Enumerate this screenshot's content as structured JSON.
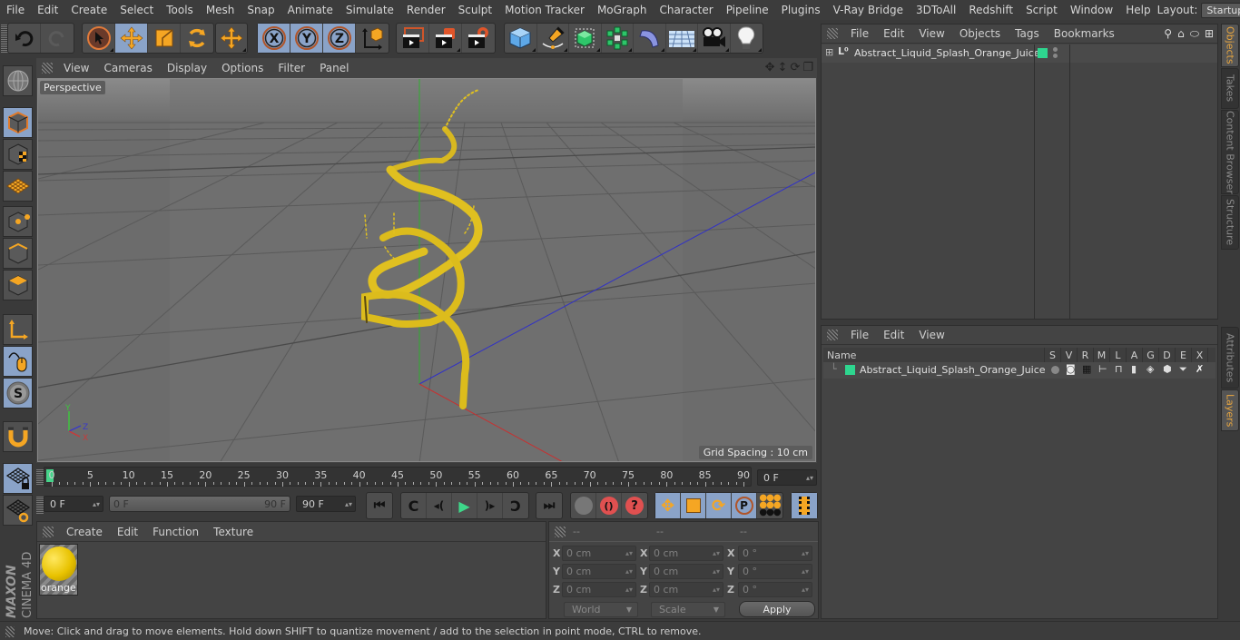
{
  "menubar": {
    "items": [
      "File",
      "Edit",
      "Create",
      "Select",
      "Tools",
      "Mesh",
      "Snap",
      "Animate",
      "Simulate",
      "Render",
      "Sculpt",
      "Motion Tracker",
      "MoGraph",
      "Character",
      "Pipeline",
      "Plugins",
      "V-Ray Bridge",
      "3DToAll",
      "Redshift",
      "Script",
      "Window",
      "Help"
    ],
    "layout_label": "Layout:",
    "layout_value": "Startup"
  },
  "toolbar": {
    "undo": "undo-icon",
    "redo": "redo-icon",
    "tools": [
      "live-selection",
      "move",
      "scale",
      "rotate",
      "recent-tool"
    ],
    "axis": [
      "X",
      "Y",
      "Z"
    ],
    "coord_system": "world-coordinates-icon",
    "render": [
      "render-view",
      "render-picture-viewer",
      "render-settings"
    ],
    "objects": [
      "cube",
      "pen",
      "subdivision",
      "cloner",
      "deformer",
      "floor",
      "camera",
      "light"
    ]
  },
  "viewport": {
    "menu": [
      "View",
      "Cameras",
      "Display",
      "Options",
      "Filter",
      "Panel"
    ],
    "label": "Perspective",
    "grid_spacing": "Grid Spacing : 10 cm",
    "axis_labels": {
      "y": "Y",
      "z": "Z",
      "x": "X"
    }
  },
  "timeline": {
    "ticks": [
      "0",
      "5",
      "10",
      "15",
      "20",
      "25",
      "30",
      "35",
      "40",
      "45",
      "50",
      "55",
      "60",
      "65",
      "70",
      "75",
      "80",
      "85",
      "90"
    ],
    "current_frame": "0 F",
    "start_frame": "0 F",
    "range_start": "0 F",
    "range_end": "90 F",
    "end_frame": "90 F"
  },
  "materials": {
    "menu": [
      "Create",
      "Edit",
      "Function",
      "Texture"
    ],
    "items": [
      {
        "name": "orange",
        "color": "#e8c200"
      }
    ]
  },
  "coordinates": {
    "headers": [
      "--",
      "--",
      "--"
    ],
    "rows": [
      {
        "axis": "X",
        "pos": "0 cm",
        "size": "0 cm",
        "rot": "0 °"
      },
      {
        "axis": "Y",
        "pos": "0 cm",
        "size": "0 cm",
        "rot": "0 °"
      },
      {
        "axis": "Z",
        "pos": "0 cm",
        "size": "0 cm",
        "rot": "0 °"
      }
    ],
    "mode": "World",
    "scale_mode": "Scale",
    "apply": "Apply"
  },
  "objects_panel": {
    "menu": [
      "File",
      "Edit",
      "View",
      "Objects",
      "Tags",
      "Bookmarks"
    ],
    "objects": [
      {
        "name": "Abstract_Liquid_Splash_Orange_Juice",
        "layer_color": "#2ed68f"
      }
    ]
  },
  "layers_panel": {
    "menu": [
      "File",
      "Edit",
      "View"
    ],
    "columns": [
      "Name",
      "S",
      "V",
      "R",
      "M",
      "L",
      "A",
      "G",
      "D",
      "E",
      "X"
    ],
    "layers": [
      {
        "name": "Abstract_Liquid_Splash_Orange_Juice",
        "color": "#2ed68f"
      }
    ]
  },
  "side_tabs": {
    "top": [
      {
        "label": "Objects",
        "active": true
      },
      {
        "label": "Takes",
        "active": false
      },
      {
        "label": "Content Browser",
        "active": false
      },
      {
        "label": "Structure",
        "active": false
      }
    ],
    "bottom": [
      {
        "label": "Attributes",
        "active": false
      },
      {
        "label": "Layers",
        "active": true
      }
    ]
  },
  "branding": {
    "line1": "MAXON",
    "line2": "CINEMA 4D"
  },
  "status": "Move: Click and drag to move elements. Hold down SHIFT to quantize movement / add to the selection in point mode, CTRL to remove.",
  "colors": {
    "accent_blue": "#8aa3c8",
    "active_tab": "#e8a640",
    "layer_green": "#2ed68f",
    "splash_yellow": "#e0c020"
  }
}
